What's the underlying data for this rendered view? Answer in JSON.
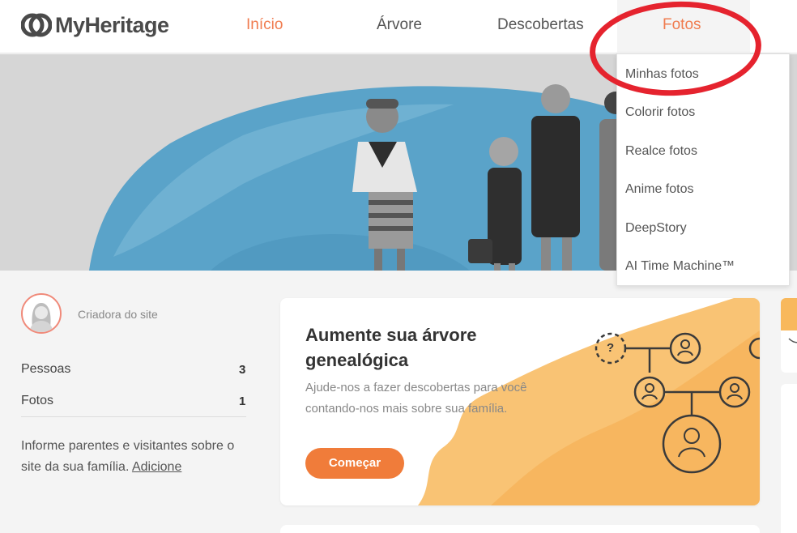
{
  "header": {
    "logo_text": "MyHeritage",
    "nav": [
      "Início",
      "Árvore",
      "Descobertas",
      "Fotos"
    ]
  },
  "dropdown": {
    "items": [
      "Minhas fotos",
      "Colorir fotos",
      "Realce fotos",
      "Anime fotos",
      "DeepStory",
      "AI Time Machine™"
    ]
  },
  "sidebar": {
    "creator_label": "Criadora do site",
    "stats": [
      {
        "label": "Pessoas",
        "value": "3"
      },
      {
        "label": "Fotos",
        "value": "1"
      }
    ],
    "invite_text": "Informe parentes e visitantes sobre o site da sua família.",
    "invite_link": "Adicione"
  },
  "card": {
    "title": "Aumente sua árvore genealógica",
    "subtitle": "Ajude-nos a fazer descobertas para você contando-nos mais sobre sua família.",
    "button": "Começar",
    "unknown_mark": "?"
  },
  "colors": {
    "accent": "#f07c4f",
    "button": "#f07c3a",
    "highlight_circle": "#e5232e",
    "watercolor_blue": "#5aa3c9",
    "watercolor_orange": "#f8b85c"
  }
}
